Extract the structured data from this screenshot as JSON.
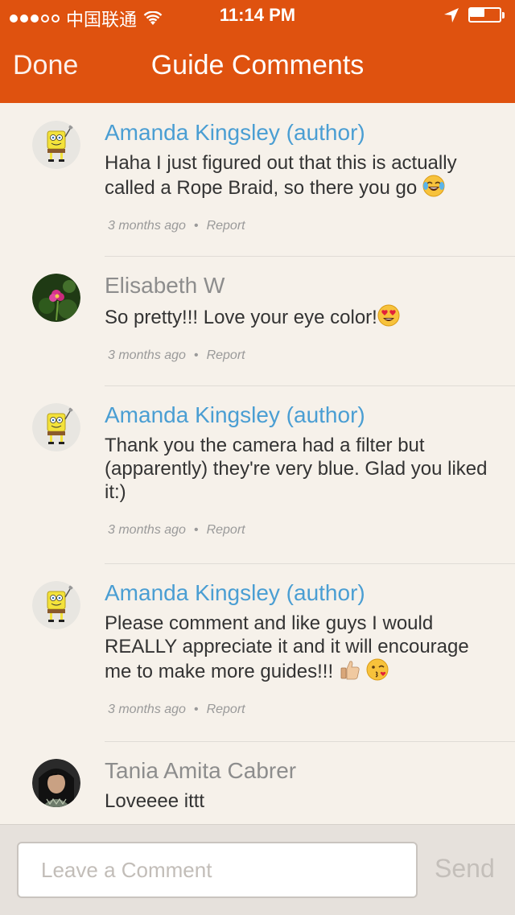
{
  "status_bar": {
    "carrier": "中国联通",
    "time": "11:14 PM",
    "signal_bars_filled": 3,
    "signal_bars_total": 5,
    "battery_level": 0.5
  },
  "nav": {
    "done_label": "Done",
    "title": "Guide Comments"
  },
  "comments": [
    {
      "author": "Amanda Kingsley (author)",
      "is_author": true,
      "avatar": "spongebob-avatar",
      "text": "Haha I just figured out that this is actually called a Rope Braid, so there you go",
      "emoji": [
        "tears-of-joy-emoji"
      ],
      "time": "3 months ago",
      "report": "Report"
    },
    {
      "author": "Elisabeth W",
      "is_author": false,
      "avatar": "flower-avatar",
      "text": "So pretty!!! Love your eye color!",
      "emoji": [
        "heart-eyes-emoji"
      ],
      "time": "3 months ago",
      "report": "Report"
    },
    {
      "author": "Amanda Kingsley (author)",
      "is_author": true,
      "avatar": "spongebob-avatar",
      "text": "Thank you the camera had a filter but (apparently) they're very blue. Glad you liked it:)",
      "emoji": [],
      "time": "3 months ago",
      "report": "Report"
    },
    {
      "author": "Amanda Kingsley (author)",
      "is_author": true,
      "avatar": "spongebob-avatar",
      "text": "Please comment and like guys I would REALLY appreciate it and it will encourage me to make more guides!!!",
      "emoji": [
        "thumbs-up-emoji",
        "kiss-emoji"
      ],
      "time": "3 months ago",
      "report": "Report"
    },
    {
      "author": "Tania Amita Cabrer",
      "is_author": false,
      "avatar": "person-avatar",
      "text": "Loveeee ittt",
      "emoji": [],
      "time": "",
      "report": ""
    }
  ],
  "input_bar": {
    "placeholder": "Leave a Comment",
    "value": "",
    "send_label": "Send"
  },
  "colors": {
    "header": "#df520f",
    "author_link": "#4a9ed3",
    "background": "#f6f1ea"
  }
}
